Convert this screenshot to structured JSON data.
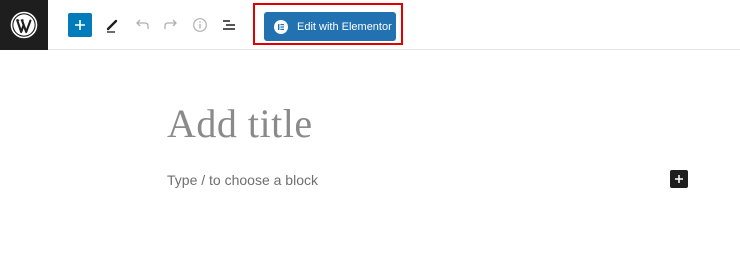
{
  "toolbar": {
    "logo_icon": "wordpress-icon",
    "items": [
      {
        "name": "block-inserter",
        "icon": "plus-icon"
      },
      {
        "name": "tools",
        "icon": "pencil-icon"
      },
      {
        "name": "undo",
        "icon": "undo-icon"
      },
      {
        "name": "redo",
        "icon": "redo-icon"
      },
      {
        "name": "details",
        "icon": "info-icon"
      },
      {
        "name": "list-view",
        "icon": "list-icon"
      }
    ],
    "elementor_button": {
      "label": "Edit with Elementor",
      "icon": "elementor-icon",
      "color": "#2271b1",
      "highlight_color": "#e00000"
    }
  },
  "editor": {
    "title_placeholder": "Add title",
    "block_placeholder": "Type / to choose a block",
    "add_block_icon": "plus-icon"
  },
  "colors": {
    "logo_bg": "#1e1e1e",
    "inserter_bg": "#007cba"
  }
}
